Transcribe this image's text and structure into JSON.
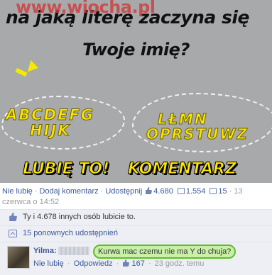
{
  "meme": {
    "watermark": "www.wiocha.pl",
    "line1": "na jaką literę zaczyna się",
    "line2": "Twoje imię?",
    "group_left_row1": "ABCDEFG",
    "group_left_row2": "HIJK",
    "group_right_row1": "LŁMN",
    "group_right_row2": "OPRSTUWZ",
    "like_label": "LUBIĘ TO!",
    "comment_label": "KOMENTARZ",
    "colors": {
      "letters": "#ffe600",
      "background": "#a7a9ab"
    }
  },
  "post_actions": {
    "unlike": "Nie lubię",
    "comment": "Dodaj komentarz",
    "share": "Udostępnij",
    "like_count": "4.680",
    "comment_count": "1.554",
    "share_count": "15",
    "overflow": "13",
    "time": "czerwca o 14:52"
  },
  "likes": {
    "text": "Ty i 4.678 innych osób lubicie to.",
    "icon": "thumb-up-icon"
  },
  "shares": {
    "text": "15 ponownych udostępnień",
    "icon": "share-icon"
  },
  "comment": {
    "author": "Yilma:",
    "text": "Kurwa mac czemu nie ma Y do chuja?",
    "unlike": "Nie lubię",
    "reply": "Odpowiedz",
    "like_count": "167",
    "time": "23 godz. temu",
    "highlight_color": "#5dbe2a"
  }
}
